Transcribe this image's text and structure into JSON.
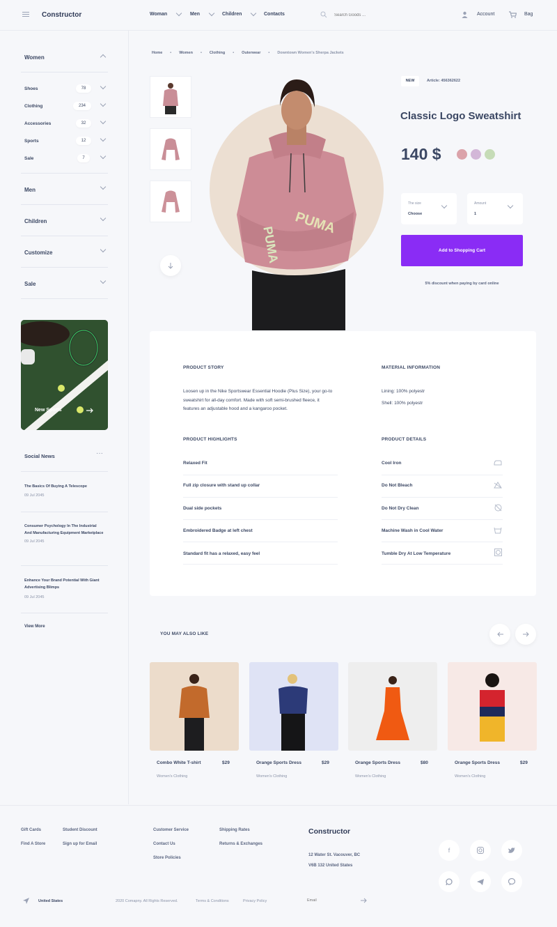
{
  "header": {
    "logo": "Constructor",
    "nav": [
      "Woman",
      "Men",
      "Children",
      "Contacts"
    ],
    "search_placeholder": "Search Goods ...",
    "account": "Account",
    "bag": "Bag"
  },
  "sidebar": {
    "women_title": "Women",
    "categories": [
      {
        "label": "Shoes",
        "count": "78"
      },
      {
        "label": "Clothing",
        "count": "234"
      },
      {
        "label": "Accessories",
        "count": "32"
      },
      {
        "label": "Sports",
        "count": "12"
      },
      {
        "label": "Sale",
        "count": "7"
      }
    ],
    "groups": [
      "Men",
      "Children",
      "Customize",
      "Sale"
    ],
    "promo_label": "New Sports",
    "social_title": "Social News",
    "news": [
      {
        "title": "The Basics Of Buying A Telescope",
        "date": "09 Jul 2045"
      },
      {
        "title": "Consumer Psychology In The Industrial And Manufacturing Equipment Marketplace",
        "date": "09 Jul 2045"
      },
      {
        "title": "Enhance Your Brand Potential With Giant Advertising Blimps",
        "date": "09 Jul 2045"
      }
    ],
    "view_more": "View More"
  },
  "breadcrumb": [
    "Home",
    "Women",
    "Clothing",
    "Outerwear",
    "Downtown Women's Sherpa Jackets"
  ],
  "product": {
    "badge": "NEW",
    "article": "Article: 456362622",
    "title": "Classic Logo Sweatshirt",
    "price": "140 $",
    "swatches": [
      "#dba3aa",
      "#d3b7d8",
      "#c6dcb7"
    ],
    "size_label": "The size",
    "size_value": "Choose",
    "amount_label": "Amount",
    "amount_value": "1",
    "cart_button": "Add to Shopping Cart",
    "discount": "5% discount when paying by card online"
  },
  "info": {
    "story_title": "PRODUCT STORY",
    "story_text": [
      "Loosen up in the Nike Sportswear Essential Hoodie (Plus Size), your go-to",
      "sweatshirt for all-day comfort. Made with soft semi-brushed fleece, it",
      "features an adjustable hood and a kangaroo pocket."
    ],
    "material_title": "MATERIAL INFORMATION",
    "material": [
      "Lining: 100% polyestr",
      "Shell: 100% polyestr"
    ],
    "highlights_title": "PRODUCT HIGHLIGHTS",
    "highlights": [
      "Relaxed Fit",
      "Full zip closure with stand up collar",
      "Dual side pockets",
      "Embroidered Badge at left chest",
      "Standard fit has a relaxed, easy feel"
    ],
    "details_title": "PRODUCT DETAILS",
    "details": [
      "Cool Iron",
      "Do Not Bleach",
      "Do Not Dry Clean",
      "Machine Wash in Cool Water",
      "Tumble Dry At Low Temperature"
    ]
  },
  "related": {
    "title": "YOU MAY ALSO LIKE",
    "items": [
      {
        "name": "Combo White T-shirt",
        "price": "$29",
        "cat": "Women's Clothing",
        "bg": "#ecdccb"
      },
      {
        "name": "Orange Sports Dress",
        "price": "$29",
        "cat": "Women's Clothing",
        "bg": "#dfe3f5"
      },
      {
        "name": "Orange Sports Dress",
        "price": "$80",
        "cat": "Women's Clothing",
        "bg": "#eeeeee"
      },
      {
        "name": "Orange Sports Dress",
        "price": "$29",
        "cat": "Women's Clothing",
        "bg": "#f7e9e6"
      }
    ]
  },
  "footer": {
    "col1": [
      "Gift Cards",
      "Find A Store"
    ],
    "col2": [
      "Student Discount",
      "Sign up for Email"
    ],
    "col3": [
      "Customer Service",
      "Contact Us",
      "Store Policies"
    ],
    "col4": [
      "Shipping Rates",
      "Returns & Exchanges"
    ],
    "brand": "Constructor",
    "address1": "12 Water St. Vacouver, BC",
    "address2": "V6B 132 United States",
    "country": "United States",
    "copyright": "2020 Comapny. All Rights Reserved.",
    "terms": "Terms & Conditions",
    "privacy": "Privacy Policy",
    "email_placeholder": "Email"
  }
}
